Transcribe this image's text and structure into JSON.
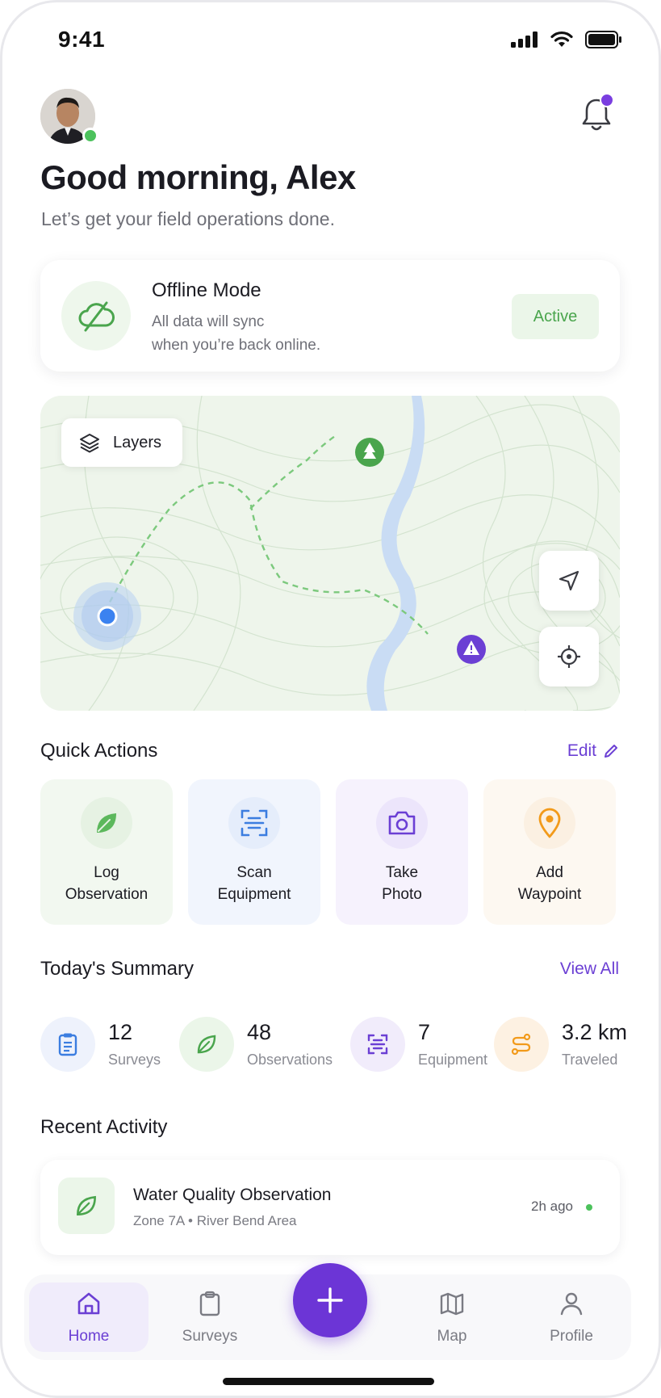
{
  "status_bar": {
    "time": "9:41"
  },
  "header": {
    "greeting": "Good morning, Alex",
    "subtitle": "Let’s get your field operations done."
  },
  "offline": {
    "title": "Offline Mode",
    "desc_line1": "All data will sync",
    "desc_line2": "when you’re back online.",
    "badge": "Active"
  },
  "map": {
    "layers_label": "Layers"
  },
  "quick_actions": {
    "title": "Quick Actions",
    "edit_label": "Edit",
    "items": [
      {
        "line1": "Log",
        "line2": "Observation",
        "icon": "leaf-icon",
        "bg": "#f0f7ee",
        "color": "#4aa54d"
      },
      {
        "line1": "Scan",
        "line2": "Equipment",
        "icon": "scan-icon",
        "bg": "#eef3fd",
        "color": "#3b7de0"
      },
      {
        "line1": "Take",
        "line2": "Photo",
        "icon": "camera-icon",
        "bg": "#f4f0fc",
        "color": "#6b3fd4"
      },
      {
        "line1": "Add",
        "line2": "Waypoint",
        "icon": "pin-icon",
        "bg": "#fdf6ee",
        "color": "#f29a1a"
      }
    ]
  },
  "summary": {
    "title": "Today's Summary",
    "view_all": "View All",
    "items": [
      {
        "value": "12",
        "label": "Surveys"
      },
      {
        "value": "48",
        "label": "Observations"
      },
      {
        "value": "7",
        "label": "Equipment"
      },
      {
        "value": "3.2 km",
        "label": "Traveled"
      }
    ]
  },
  "recent": {
    "title": "Recent Activity",
    "items": [
      {
        "title": "Water Quality Observation",
        "subtitle": "Zone 7A • River Bend Area",
        "time": "2h ago"
      }
    ]
  },
  "tabbar": {
    "items": [
      {
        "label": "Home"
      },
      {
        "label": "Surveys"
      },
      {
        "label": "Map"
      },
      {
        "label": "Profile"
      }
    ]
  },
  "colors": {
    "accent": "#6b3fd4",
    "success": "#4cc25c"
  }
}
